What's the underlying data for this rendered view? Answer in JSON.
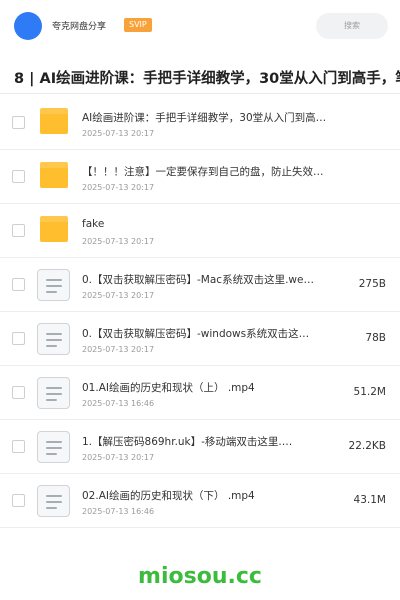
{
  "header": {
    "user_name": "夸克网盘分享",
    "badge": "SVIP",
    "search_placeholder": "搜索"
  },
  "title": "8 | AI绘画进阶课：手把手详细教学，30堂从入门到高手，笔",
  "files": [
    {
      "type": "folder",
      "name": "AI绘画进阶课：手把手详细教学，30堂从入门到高手…",
      "date": "2025-07-13 20:17",
      "size": ""
    },
    {
      "type": "folder",
      "name": "【！！！注意】一定要保存到自己的盘，防止失效！！！",
      "date": "2025-07-13 20:17",
      "size": ""
    },
    {
      "type": "folder",
      "name": "fake",
      "date": "2025-07-13 20:17",
      "size": ""
    },
    {
      "type": "file",
      "name": "0.【双击获取解压密码】-Mac系统双击这里.we…",
      "date": "2025-07-13 20:17",
      "size": "275B"
    },
    {
      "type": "file",
      "name": "0.【双击获取解压密码】-windows系统双击这…",
      "date": "2025-07-13 20:17",
      "size": "78B"
    },
    {
      "type": "file",
      "name": "01.AI绘画的历史和现状（上） .mp4",
      "date": "2025-07-13 16:46",
      "size": "51.2M"
    },
    {
      "type": "file",
      "name": "1.【解压密码869hr.uk】-移动端双击这里.…",
      "date": "2025-07-13 20:17",
      "size": "22.2KB"
    },
    {
      "type": "file",
      "name": "02.AI绘画的历史和现状（下） .mp4",
      "date": "2025-07-13 16:46",
      "size": "43.1M"
    }
  ],
  "watermark": "miosou.cc"
}
